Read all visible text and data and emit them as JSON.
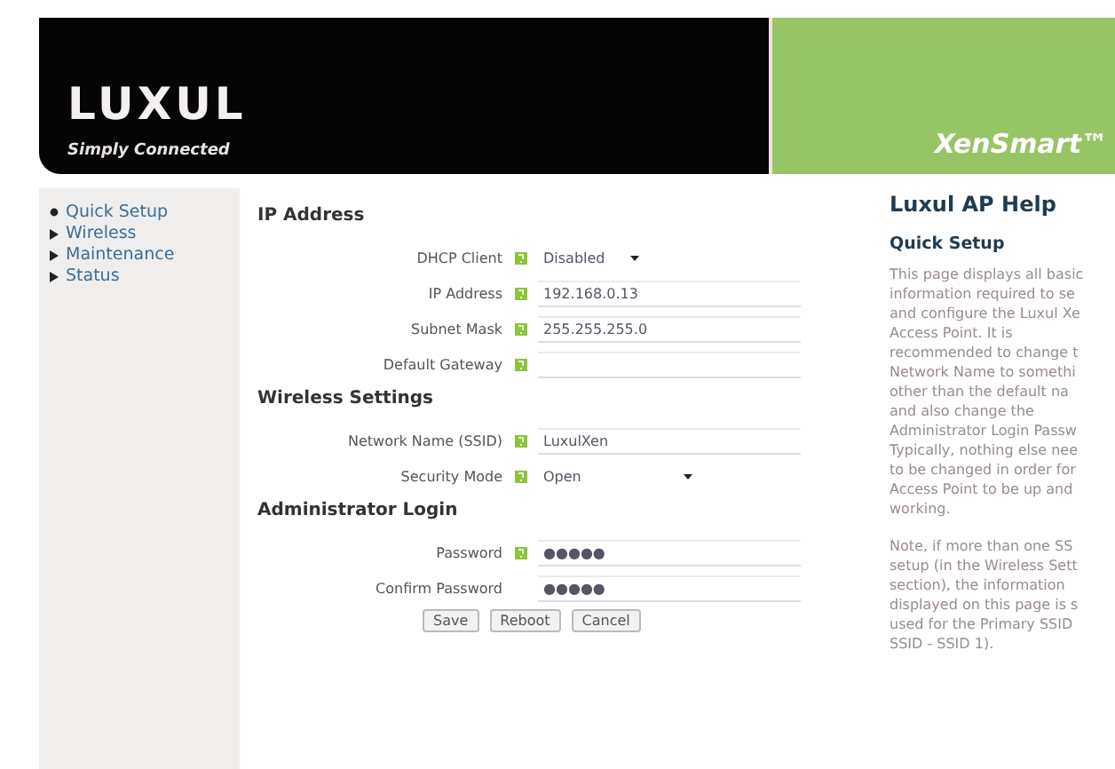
{
  "header": {
    "logo": "LUXUL",
    "tagline": "Simply Connected",
    "product": "XenSmart™"
  },
  "sidebar": {
    "items": [
      {
        "label": "Quick Setup",
        "selected": true
      },
      {
        "label": "Wireless",
        "selected": false
      },
      {
        "label": "Maintenance",
        "selected": false
      },
      {
        "label": "Status",
        "selected": false
      }
    ]
  },
  "sections": [
    {
      "title": "IP Address",
      "fields": [
        {
          "label": "DHCP Client",
          "kind": "select",
          "value": "Disabled",
          "help": true
        },
        {
          "label": "IP Address",
          "kind": "text",
          "value": "192.168.0.13",
          "help": true
        },
        {
          "label": "Subnet Mask",
          "kind": "text",
          "value": "255.255.255.0",
          "help": true
        },
        {
          "label": "Default Gateway",
          "kind": "text",
          "help": true
        }
      ]
    },
    {
      "title": "Wireless Settings",
      "fields": [
        {
          "label": "Network Name (SSID)",
          "kind": "text",
          "value": "LuxulXen",
          "help": true
        },
        {
          "label": "Security Mode",
          "kind": "select-wide",
          "value": "Open",
          "help": true
        }
      ]
    },
    {
      "title": "Administrator Login",
      "fields": [
        {
          "label": "Password",
          "kind": "text",
          "value": "●●●●●",
          "help": true
        },
        {
          "label": "Confirm Password",
          "kind": "text",
          "value": "●●●●●",
          "help": false
        }
      ]
    }
  ],
  "buttons": [
    "Save",
    "Reboot",
    "Cancel"
  ],
  "help": {
    "title": "Luxul AP Help",
    "subtitle": "Quick Setup",
    "paragraphs": [
      [
        "This page displays all basic",
        "information required to se",
        "and configure the Luxul Xe",
        "Access Point. It is",
        "recommended to change t",
        "Network Name to somethi",
        "other than the default na",
        "and also change the",
        "Administrator Login Passw",
        "Typically, nothing else nee",
        "to be changed in order for",
        "Access Point to be up and",
        "working."
      ],
      [
        "Note, if more than one SS",
        "setup (in the Wireless Sett",
        "section), the information",
        "displayed on this page is s",
        "used for the Primary SSID",
        "SSID - SSID 1)."
      ]
    ]
  }
}
